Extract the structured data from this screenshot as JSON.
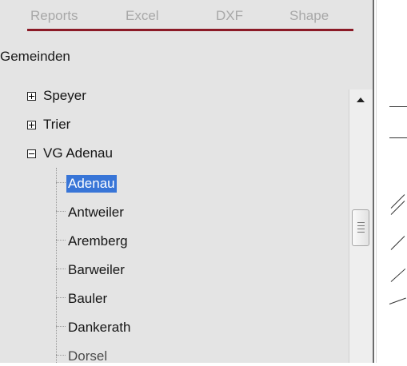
{
  "toolbar": {
    "items": [
      "Reports",
      "Excel",
      "DXF",
      "Shape"
    ]
  },
  "section_title": "Gemeinden",
  "tree": {
    "collapsed": [
      {
        "label": "Speyer",
        "toggle": "+"
      },
      {
        "label": "Trier",
        "toggle": "+"
      }
    ],
    "expanded": {
      "label": "VG Adenau",
      "toggle": "−"
    },
    "children": [
      "Adenau",
      "Antweiler",
      "Aremberg",
      "Barweiler",
      "Bauler",
      "Dankerath",
      "Dorsel"
    ],
    "selected": "Adenau"
  },
  "icons": {
    "expand": "plus-box-icon",
    "collapse": "minus-box-icon",
    "scroll_up": "chevron-up-icon",
    "scroll_thumb": "grip-icon"
  },
  "colors": {
    "accent_underline": "#8b1a26",
    "selection": "#3875d7",
    "panel_bg": "#e4e4e4",
    "toolbar_text": "#a8a8a8"
  }
}
